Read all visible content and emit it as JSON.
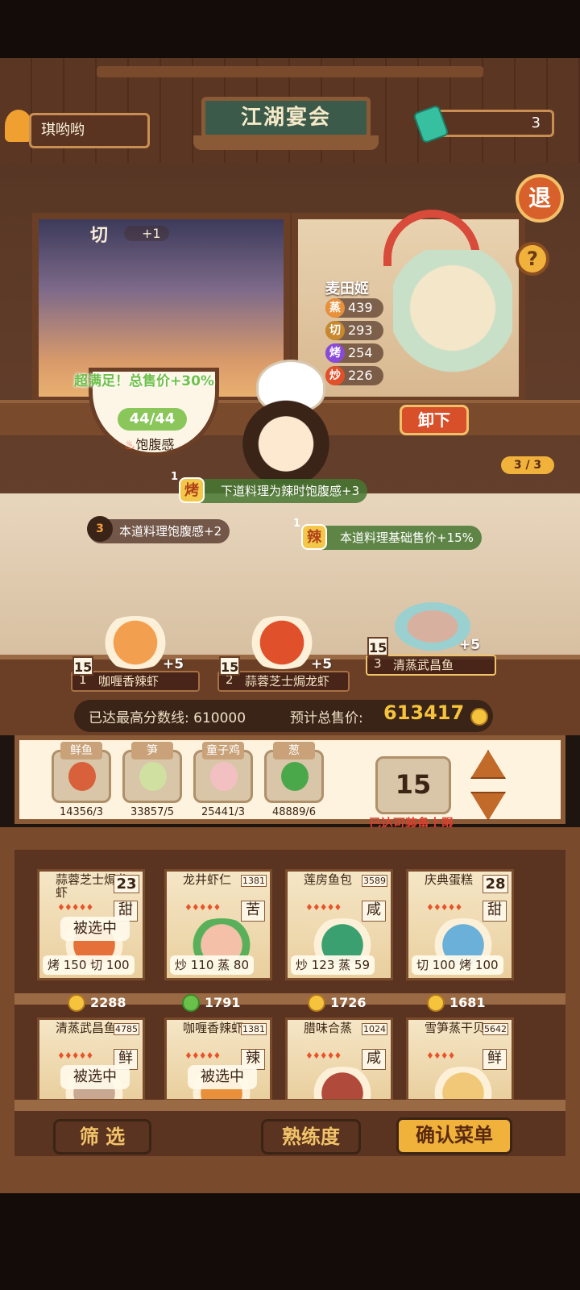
{
  "header": {
    "player_name": "琪哟哟",
    "banner_title": "江湖宴会",
    "gem_count": "3",
    "exit_label": "退",
    "help_label": "?"
  },
  "scene": {
    "cut_label": "切",
    "cut_plus": "+1",
    "chef_name": "麦田姬",
    "stats": [
      {
        "icon": "蒸",
        "value": "439",
        "color": "#e8903a"
      },
      {
        "icon": "切",
        "value": "293",
        "color": "#c8882e"
      },
      {
        "icon": "烤",
        "value": "254",
        "color": "#8a4ad8"
      },
      {
        "icon": "炒",
        "value": "226",
        "color": "#e0502a"
      }
    ],
    "unload_label": "卸下",
    "chef_count": "3 / 3",
    "satisfy_text": "超满足！总售价+30%",
    "satiety_value": "44/44",
    "satiety_label": "饱腹感",
    "effects": [
      {
        "num": "1",
        "icon": "烤",
        "text": "下道料理为辣时饱腹感+3"
      },
      {
        "num": "3",
        "icon": "",
        "text": "本道料理饱腹感+2"
      },
      {
        "num": "1",
        "icon": "辣",
        "text": "本道料理基础售价+15%"
      }
    ]
  },
  "plates": [
    {
      "level": "15",
      "index": "1",
      "name": "咖喱香辣虾",
      "bonus": "+5"
    },
    {
      "level": "15",
      "index": "2",
      "name": "蒜蓉芝士焗龙虾",
      "bonus": "+5"
    },
    {
      "level": "15",
      "index": "3",
      "name": "清蒸武昌鱼",
      "bonus": "+5"
    }
  ],
  "score": {
    "best_label": "已达最高分数线:",
    "best_value": "610000",
    "total_label": "预计总售价:",
    "total_value": "613417"
  },
  "ingredients": [
    {
      "name": "鲜鱼",
      "count": "14356/3",
      "color": "#d8603a"
    },
    {
      "name": "笋",
      "count": "33857/5",
      "color": "#cfe0a0"
    },
    {
      "name": "童子鸡",
      "count": "25441/3",
      "color": "#f2c0c0"
    },
    {
      "name": "葱",
      "count": "48889/6",
      "color": "#4aa84a"
    }
  ],
  "capacity": {
    "value": "15",
    "label": "已达可装备上限"
  },
  "recipes": [
    {
      "name": "蒜蓉芝士焗龙虾",
      "num": "23",
      "flavor": "甜",
      "selected": "被选中",
      "skills": "烤 150  切 100",
      "price": "2288",
      "food": "#e6703a"
    },
    {
      "name": "龙井虾仁",
      "num": "1381",
      "flavor": "苦",
      "selected": "",
      "skills": "炒 110  蒸 80",
      "price": "1791",
      "food": "#f4c0a8"
    },
    {
      "name": "莲房鱼包",
      "num": "3589",
      "flavor": "咸",
      "selected": "",
      "skills": "炒 123  蒸 59",
      "price": "1726",
      "food": "#3aa070"
    },
    {
      "name": "庆典蛋糕",
      "num": "28",
      "flavor": "甜",
      "selected": "",
      "skills": "切 100  烤 100",
      "price": "1681",
      "food": "#6ab0d8"
    },
    {
      "name": "清蒸武昌鱼",
      "num": "4785",
      "flavor": "鲜",
      "selected": "被选中",
      "skills": "",
      "price": "",
      "food": "#c8a890"
    },
    {
      "name": "咖喱香辣虾",
      "num": "1381",
      "flavor": "辣",
      "selected": "被选中",
      "skills": "",
      "price": "",
      "food": "#e8903a"
    },
    {
      "name": "腊味合蒸",
      "num": "1024",
      "flavor": "咸",
      "selected": "",
      "skills": "",
      "price": "",
      "food": "#b04a3a"
    },
    {
      "name": "雪笋蒸干贝",
      "num": "5642",
      "flavor": "鲜",
      "selected": "",
      "skills": "",
      "price": "",
      "food": "#f0c878"
    }
  ],
  "buttons": {
    "filter": "筛 选",
    "proficiency": "熟练度",
    "confirm": "确认菜单"
  }
}
